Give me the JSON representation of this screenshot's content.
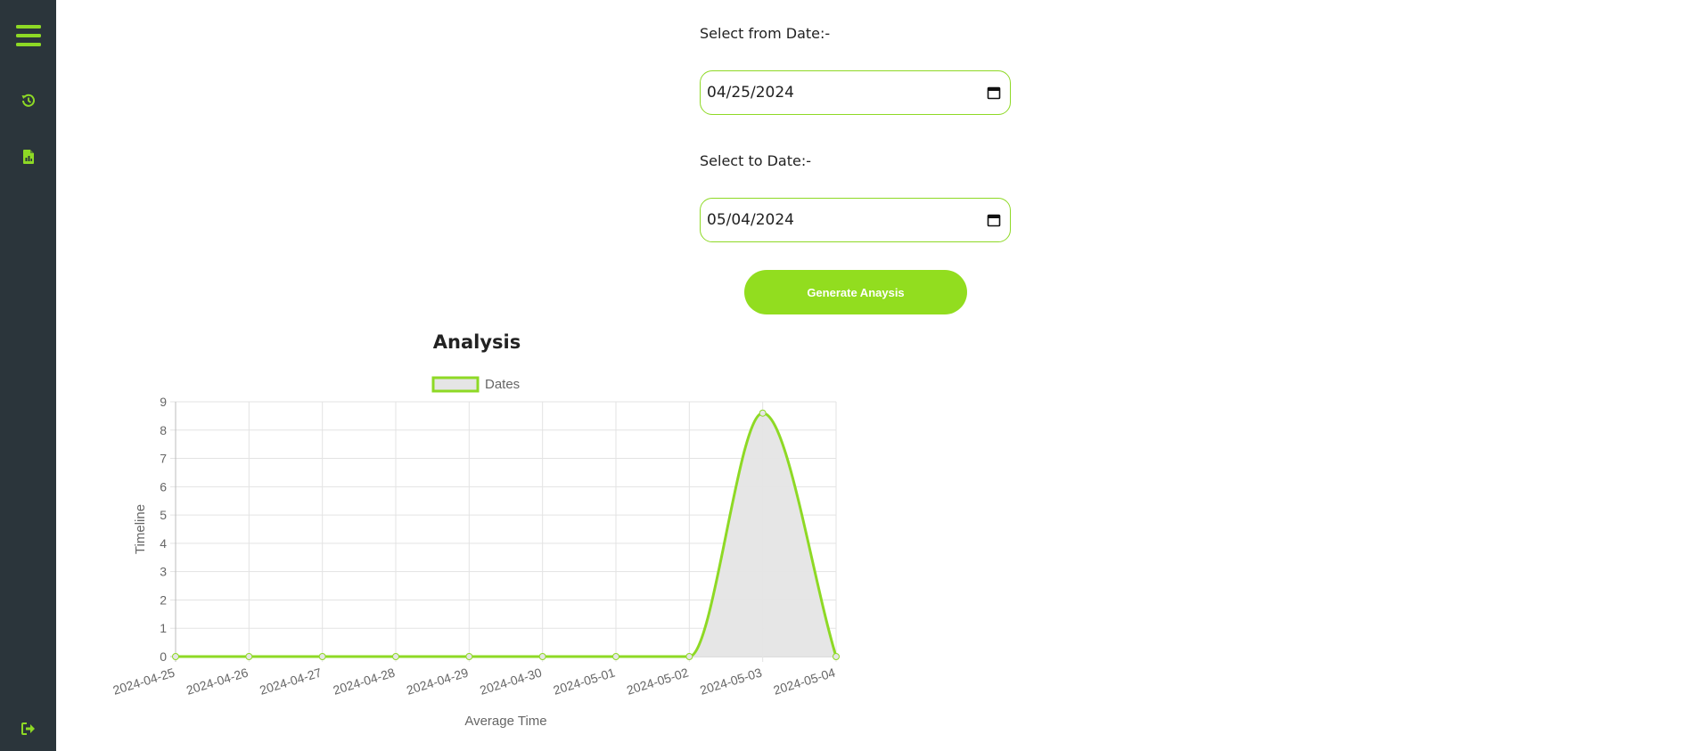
{
  "sidebar": {
    "icons": [
      "menu-icon",
      "history-icon",
      "report-icon",
      "logout-icon"
    ],
    "accent_color": "#8ed925",
    "bg_color": "#2b353b"
  },
  "form": {
    "from_label": "Select from Date:-",
    "from_value": "04/25/2024",
    "to_label": "Select to Date:-",
    "to_value": "05/04/2024",
    "generate_label": "Generate Anaysis"
  },
  "chart_data": {
    "type": "line",
    "title": "Analysis",
    "xlabel": "Average Time",
    "ylabel": "Timeline",
    "categories": [
      "2024-04-25",
      "2024-04-26",
      "2024-04-27",
      "2024-04-28",
      "2024-04-29",
      "2024-04-30",
      "2024-05-01",
      "2024-05-02",
      "2024-05-03",
      "2024-05-04"
    ],
    "series": [
      {
        "name": "Dates",
        "values": [
          0,
          0,
          0,
          0,
          0,
          0,
          0,
          0,
          8.6,
          0
        ],
        "color": "#8ed925",
        "fill": "#e5e5e5"
      }
    ],
    "ylim": [
      0,
      9
    ],
    "yticks": [
      0,
      1,
      2,
      3,
      4,
      5,
      6,
      7,
      8,
      9
    ],
    "grid": true,
    "legend": "top"
  }
}
